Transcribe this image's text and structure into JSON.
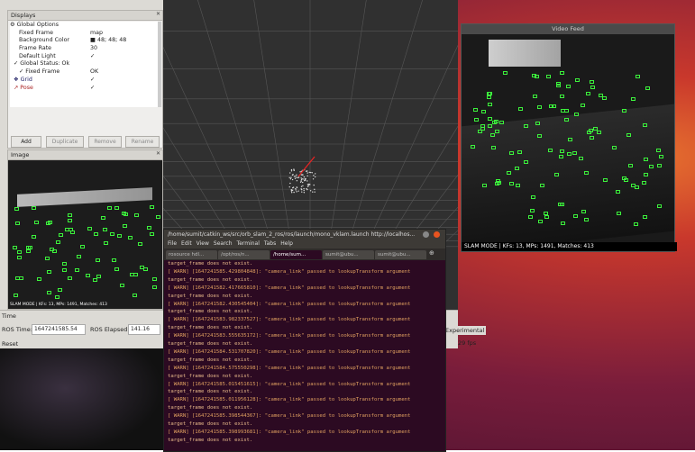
{
  "rviz": {
    "displays": {
      "title": "Displays",
      "rows": [
        {
          "k": "⚙ Global Options",
          "v": ""
        },
        {
          "k": "Fixed Frame",
          "v": "map"
        },
        {
          "k": "Background Color",
          "v": "■ 48; 48; 48"
        },
        {
          "k": "Frame Rate",
          "v": "30"
        },
        {
          "k": "Default Light",
          "v": "✓"
        },
        {
          "k": "✓ Global Status: Ok",
          "v": ""
        },
        {
          "k": "✓ Fixed Frame",
          "v": "OK"
        },
        {
          "k": "❖ Grid",
          "v": "✓"
        },
        {
          "k": "↗ Pose",
          "v": "✓"
        }
      ],
      "buttons": {
        "add": "Add",
        "duplicate": "Duplicate",
        "remove": "Remove",
        "rename": "Rename"
      }
    },
    "image_panel": {
      "title": "Image",
      "overlay": "SLAM MODE | KFs: 13, MPs: 1491, Matches: 413"
    },
    "time": {
      "title": "Time",
      "ros_time_label": "ROS Time:",
      "ros_time_value": "1647241585.54",
      "ros_elapsed_label": "ROS Elapsed:",
      "ros_elapsed_value": "141.16",
      "reset": "Reset",
      "experimental": "Experimental",
      "fps": "29 fps"
    }
  },
  "video_feed": {
    "title": "Video Feed",
    "status": "SLAM MODE |  KFs: 13, MPs: 1491, Matches: 413"
  },
  "terminal": {
    "title": "/home/sumit/catkin_ws/src/orb_slam_2_ros/ros/launch/mono_vklam.launch http://localhos...",
    "menu": [
      "File",
      "Edit",
      "View",
      "Search",
      "Terminal",
      "Tabs",
      "Help"
    ],
    "tabs": [
      "rosource hdl...",
      "/opt/ros/n...",
      "/home/sum...",
      "sumit@ubu...",
      "sumit@ubu..."
    ],
    "lines": [
      "target_frame does not exist.",
      "[ WARN] [1647241585.429804848]: \"camera_link\" passed to lookupTransform argument",
      "target_frame does not exist.",
      "[ WARN] [1647241582.417665810]: \"camera_link\" passed to lookupTransform argument",
      "target_frame does not exist.",
      "[ WARN] [1647241582.430545404]: \"camera_link\" passed to lookupTransform argument",
      "target_frame does not exist.",
      "[ WARN] [1647241583.982337527]: \"camera_link\" passed to lookupTransform argument",
      "target_frame does not exist.",
      "[ WARN] [1647241583.555635172]: \"camera_link\" passed to lookupTransform argument",
      "target_frame does not exist.",
      "[ WARN] [1647241584.531707820]: \"camera_link\" passed to lookupTransform argument",
      "target_frame does not exist.",
      "[ WARN] [1647241584.575550298]: \"camera_link\" passed to lookupTransform argument",
      "target_frame does not exist.",
      "[ WARN] [1647241585.015451615]: \"camera_link\" passed to lookupTransform argument",
      "target_frame does not exist.",
      "[ WARN] [1647241585.011956128]: \"camera_link\" passed to lookupTransform argument",
      "target_frame does not exist.",
      "[ WARN] [1647241585.398544367]: \"camera_link\" passed to lookupTransform argument",
      "target_frame does not exist.",
      "[ WARN] [1647241585.398993681]: \"camera_link\" passed to lookupTransform argument",
      "target_frame does not exist."
    ]
  }
}
